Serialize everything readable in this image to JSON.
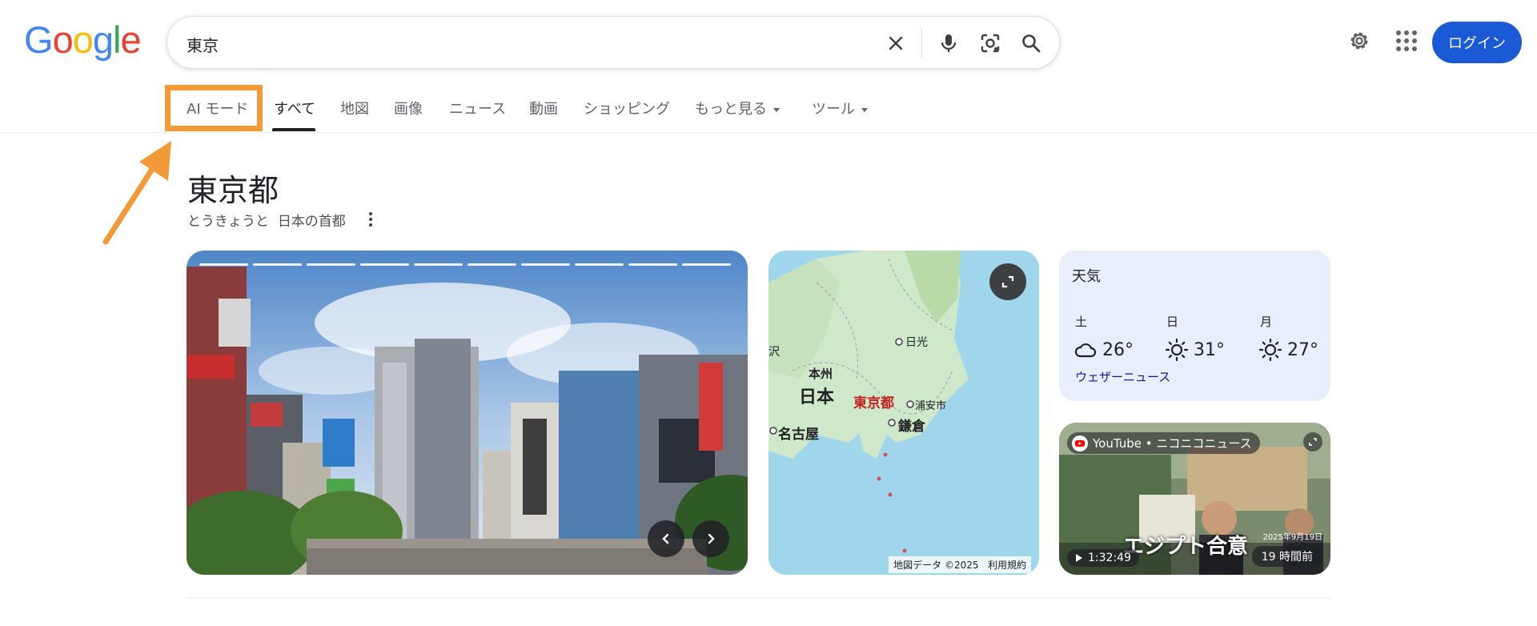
{
  "header": {
    "logo_letters": [
      {
        "char": "G",
        "color": "#4285F4"
      },
      {
        "char": "o",
        "color": "#EA4335"
      },
      {
        "char": "o",
        "color": "#FBBC05"
      },
      {
        "char": "g",
        "color": "#4285F4"
      },
      {
        "char": "l",
        "color": "#34A853"
      },
      {
        "char": "e",
        "color": "#EA4335"
      }
    ],
    "search_query": "東京",
    "login_label": "ログイン",
    "icons": [
      "clear-icon",
      "mic-icon",
      "lens-icon",
      "search-icon",
      "settings-icon",
      "apps-icon"
    ]
  },
  "tabs": [
    {
      "label": "AI モード",
      "active": false
    },
    {
      "label": "すべて",
      "active": true
    },
    {
      "label": "地図",
      "active": false
    },
    {
      "label": "画像",
      "active": false
    },
    {
      "label": "ニュース",
      "active": false
    },
    {
      "label": "動画",
      "active": false
    },
    {
      "label": "ショッピング",
      "active": false
    },
    {
      "label": "もっと見る",
      "active": false,
      "dropdown": true
    },
    {
      "label": "ツール",
      "active": false,
      "dropdown": true
    }
  ],
  "annotation": {
    "highlight_color": "#f29a38",
    "target": "AI モード"
  },
  "entity": {
    "title": "東京都",
    "subtitle": "とうきょうと",
    "description": "日本の首都"
  },
  "map": {
    "labels": [
      "日光",
      "本州",
      "日本",
      "東京都",
      "浦安市",
      "鎌倉",
      "名古屋",
      "沢"
    ],
    "attribution": "地図データ ©2025",
    "terms": "利用規約"
  },
  "weather": {
    "title": "天気",
    "days": [
      {
        "day": "土",
        "temp": "26°",
        "icon": "cloud-icon"
      },
      {
        "day": "日",
        "temp": "31°",
        "icon": "sun-icon"
      },
      {
        "day": "月",
        "temp": "27°",
        "icon": "sun-icon"
      }
    ],
    "link": "ウェザーニュース"
  },
  "video": {
    "source": "YouTube • ニコニコニュース",
    "duration": "1:32:49",
    "age": "19 時間前",
    "caption_overlay": "エジプト合意",
    "date_overlay": "2025年9月19日"
  },
  "photo_carousel": {
    "slide_count": 10
  }
}
